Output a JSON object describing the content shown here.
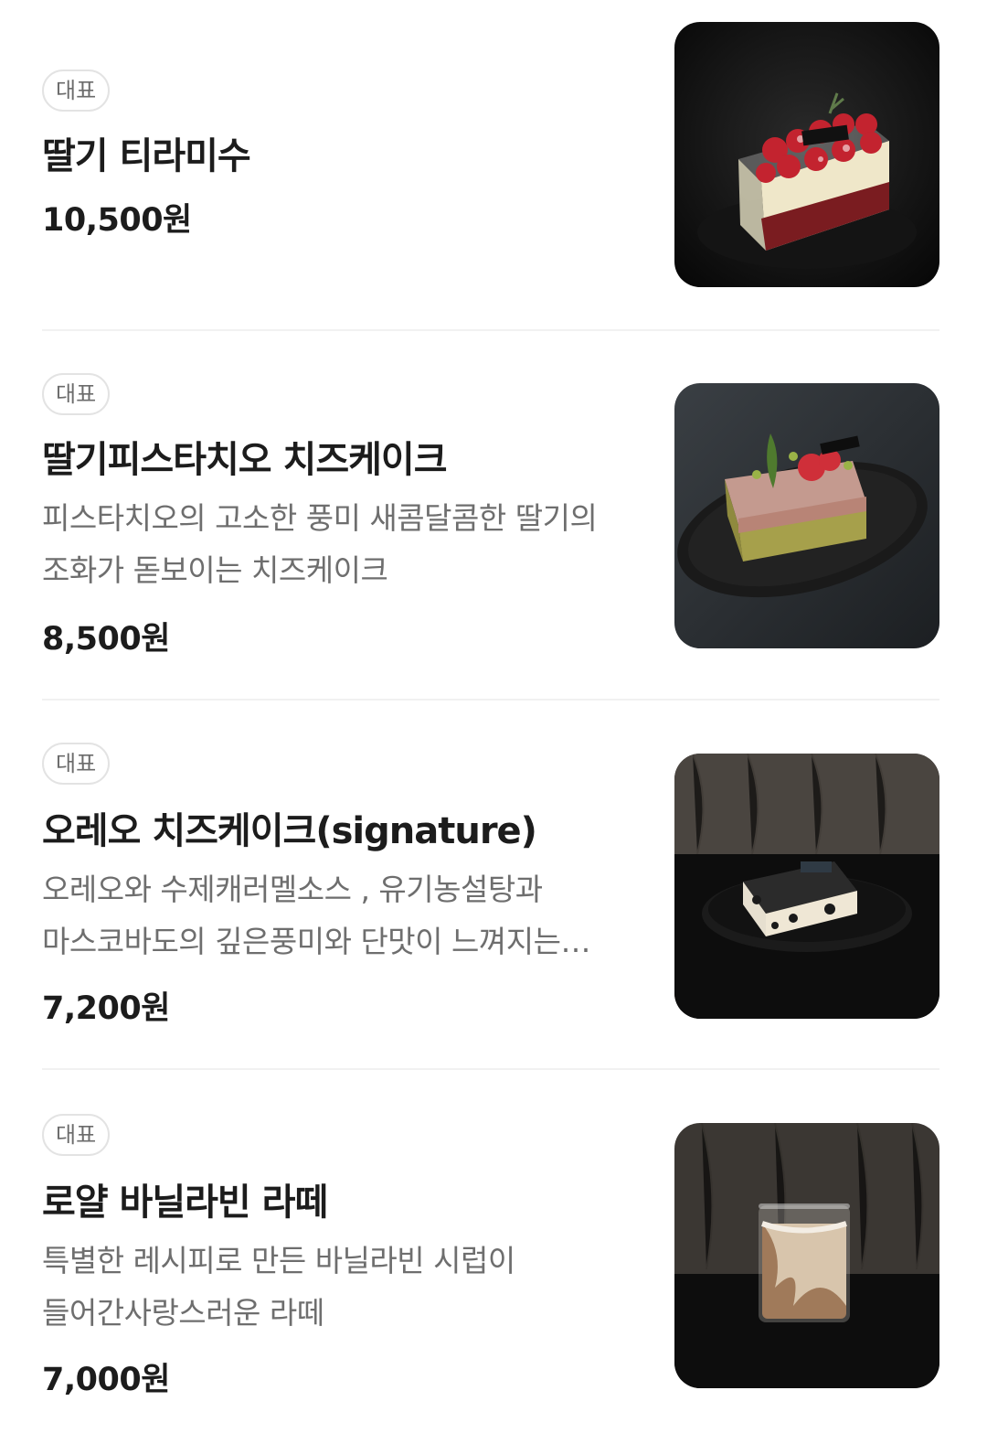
{
  "menu": {
    "items": [
      {
        "badge": "대표",
        "name": "딸기 티라미수",
        "description": "",
        "price": "10,500원",
        "image_icon": "strawberry-tiramisu-photo"
      },
      {
        "badge": "대표",
        "name": "딸기피스타치오 치즈케이크",
        "description": "피스타치오의 고소한 풍미 새콤달콤한 딸기의 조화가 돋보이는 치즈케이크",
        "price": "8,500원",
        "image_icon": "strawberry-pistachio-cheesecake-photo"
      },
      {
        "badge": "대표",
        "name": "오레오 치즈케이크(signature)",
        "description": "오레오와 수제캐러멜소스 , 유기농설탕과 마스코바도의 깊은풍미와 단맛이 느껴지는 오레오 치즈케이크",
        "price": "7,200원",
        "image_icon": "oreo-cheesecake-photo"
      },
      {
        "badge": "대표",
        "name": "로얄 바닐라빈 라떼",
        "description": "특별한 레시피로 만든 바닐라빈 시럽이 들어간사랑스러운 라떼",
        "price": "7,000원",
        "image_icon": "vanilla-bean-latte-photo"
      }
    ]
  }
}
